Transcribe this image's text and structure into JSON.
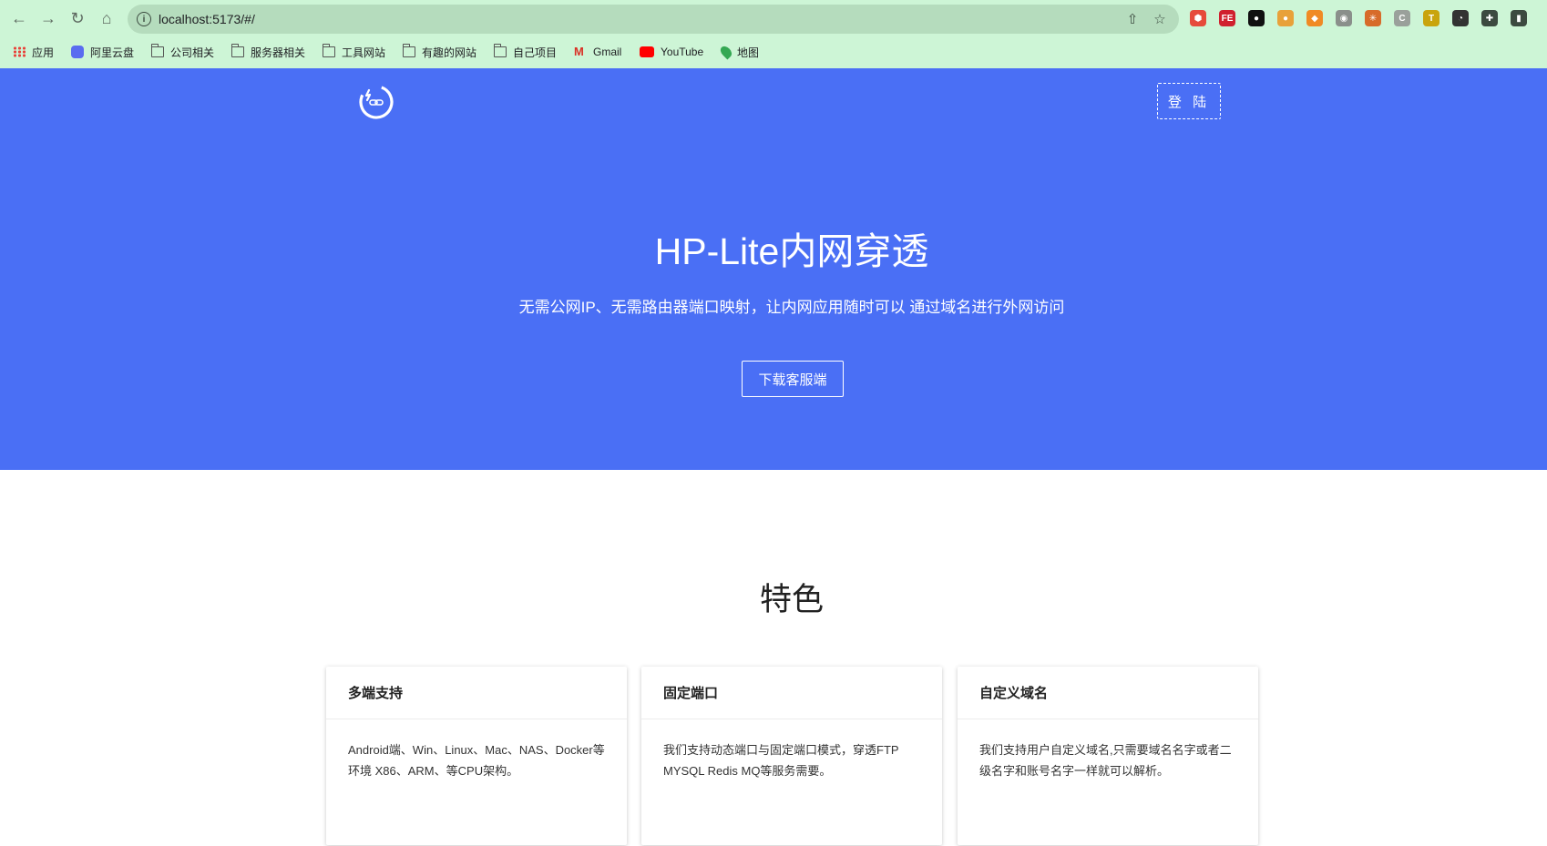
{
  "browser": {
    "url": "localhost:5173/#/",
    "bookmarks": [
      {
        "label": "应用",
        "icon": "apps-grid-icon"
      },
      {
        "label": "阿里云盘",
        "icon": "aliyun-drive-icon"
      },
      {
        "label": "公司相关",
        "icon": "folder-icon"
      },
      {
        "label": "服务器相关",
        "icon": "folder-icon"
      },
      {
        "label": "工具网站",
        "icon": "folder-icon"
      },
      {
        "label": "有趣的网站",
        "icon": "folder-icon"
      },
      {
        "label": "自己项目",
        "icon": "folder-icon"
      },
      {
        "label": "Gmail",
        "icon": "gmail-icon"
      },
      {
        "label": "YouTube",
        "icon": "youtube-icon"
      },
      {
        "label": "地图",
        "icon": "maps-pin-icon"
      }
    ],
    "extensions": [
      {
        "name": "red-dice-extension-icon",
        "color": "#e64a3b",
        "glyph": "⬢"
      },
      {
        "name": "fe-extension-icon",
        "color": "#d0202e",
        "glyph": "FE"
      },
      {
        "name": "black-circle-extension-icon",
        "color": "#111111",
        "glyph": "●"
      },
      {
        "name": "cookie-extension-icon",
        "color": "#e8a13a",
        "glyph": "●"
      },
      {
        "name": "metamask-extension-icon",
        "color": "#f08a24",
        "glyph": "◆"
      },
      {
        "name": "camera-extension-icon",
        "color": "#8a8f8b",
        "glyph": "◉"
      },
      {
        "name": "palm-tree-extension-icon",
        "color": "#d76b2a",
        "glyph": "✳"
      },
      {
        "name": "ci-extension-icon",
        "color": "#9aa09b",
        "glyph": "C"
      },
      {
        "name": "t-extension-icon",
        "color": "#c9a40d",
        "glyph": "T"
      },
      {
        "name": "clock-extension-icon",
        "color": "#333333",
        "glyph": "◔"
      },
      {
        "name": "puzzle-extensions-icon",
        "color": "#3c4a40",
        "glyph": "✚"
      },
      {
        "name": "side-panel-icon",
        "color": "#3c4a40",
        "glyph": "▮"
      }
    ]
  },
  "header": {
    "login_label": "登 陆"
  },
  "hero": {
    "title": "HP-Lite内网穿透",
    "subtitle": "无需公网IP、无需路由器端口映射，让内网应用随时可以 通过域名进行外网访问",
    "download_label": "下载客服端"
  },
  "features": {
    "title": "特色",
    "cards": [
      {
        "title": "多端支持",
        "body": "Android端、Win、Linux、Mac、NAS、Docker等环境 X86、ARM、等CPU架构。"
      },
      {
        "title": "固定端口",
        "body": "我们支持动态端口与固定端口模式，穿透FTP MYSQL Redis MQ等服务需要。"
      },
      {
        "title": "自定义域名",
        "body": "我们支持用户自定义域名,只需要域名名字或者二级名字和账号名字一样就可以解析。"
      }
    ]
  }
}
